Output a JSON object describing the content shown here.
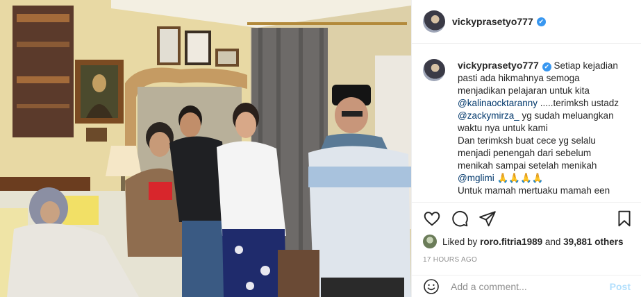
{
  "post": {
    "photo_alt": ""
  },
  "header": {
    "username": "vickyprasetyo777",
    "verified_mark": "✔"
  },
  "caption": {
    "username": "vickyprasetyo777",
    "verified_mark": "✔",
    "lines": [
      "Setiap kejadian",
      "pasti ada hikmahnya semoga",
      "menjadikan pelajaran untuk kita",
      "@kalinaocktaranny",
      " .....terimksh ustadz",
      "@zackymirza_",
      " yg sudah meluangkan",
      "waktu nya untuk kami",
      "Dan terimksh buat cece yg selalu",
      "menjadi penengah dari sebelum",
      "menikah sampai setelah menikah",
      "@mglimi",
      " 🙏🙏🙏🙏",
      "Untuk mamah mertuaku mamah een"
    ]
  },
  "actions": {
    "like_icon": "heart-icon",
    "comment_icon": "comment-bubble-icon",
    "share_icon": "paper-plane-icon",
    "save_icon": "bookmark-icon"
  },
  "likes": {
    "prefix": "Liked by ",
    "user": "roro.fitria1989",
    "middle": " and ",
    "others": "39,881 others"
  },
  "timestamp": "17 HOURS AGO",
  "comment_box": {
    "placeholder": "Add a comment...",
    "post_label": "Post",
    "emoji_icon": "smiley-icon"
  },
  "colors": {
    "verified": "#3897f0",
    "mention": "#00376b",
    "post_disabled": "#b2dffc",
    "muted": "#8e8e8e"
  }
}
